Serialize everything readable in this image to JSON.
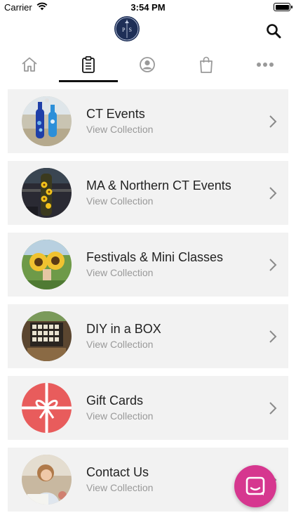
{
  "status_bar": {
    "carrier": "Carrier",
    "time": "3:54 PM"
  },
  "header": {
    "logo_letters": [
      "P",
      "S"
    ]
  },
  "nav": {
    "tabs": [
      {
        "icon": "home-icon"
      },
      {
        "icon": "clipboard-icon",
        "active": true
      },
      {
        "icon": "user-icon"
      },
      {
        "icon": "shopping-bag-icon"
      },
      {
        "icon": "more-icon"
      }
    ]
  },
  "collections": [
    {
      "title": "CT Events",
      "subtitle": "View Collection"
    },
    {
      "title": "MA & Northern CT Events",
      "subtitle": "View Collection"
    },
    {
      "title": "Festivals & Mini Classes",
      "subtitle": "View Collection"
    },
    {
      "title": "DIY in a BOX",
      "subtitle": "View Collection"
    },
    {
      "title": "Gift Cards",
      "subtitle": "View Collection"
    },
    {
      "title": "Contact Us",
      "subtitle": "View Collection"
    }
  ],
  "colors": {
    "accent_chat": "#d6378f",
    "logo_bg": "#1e2f57",
    "card_bg": "#f2f2f2",
    "gift_card": "#e85c5c"
  }
}
